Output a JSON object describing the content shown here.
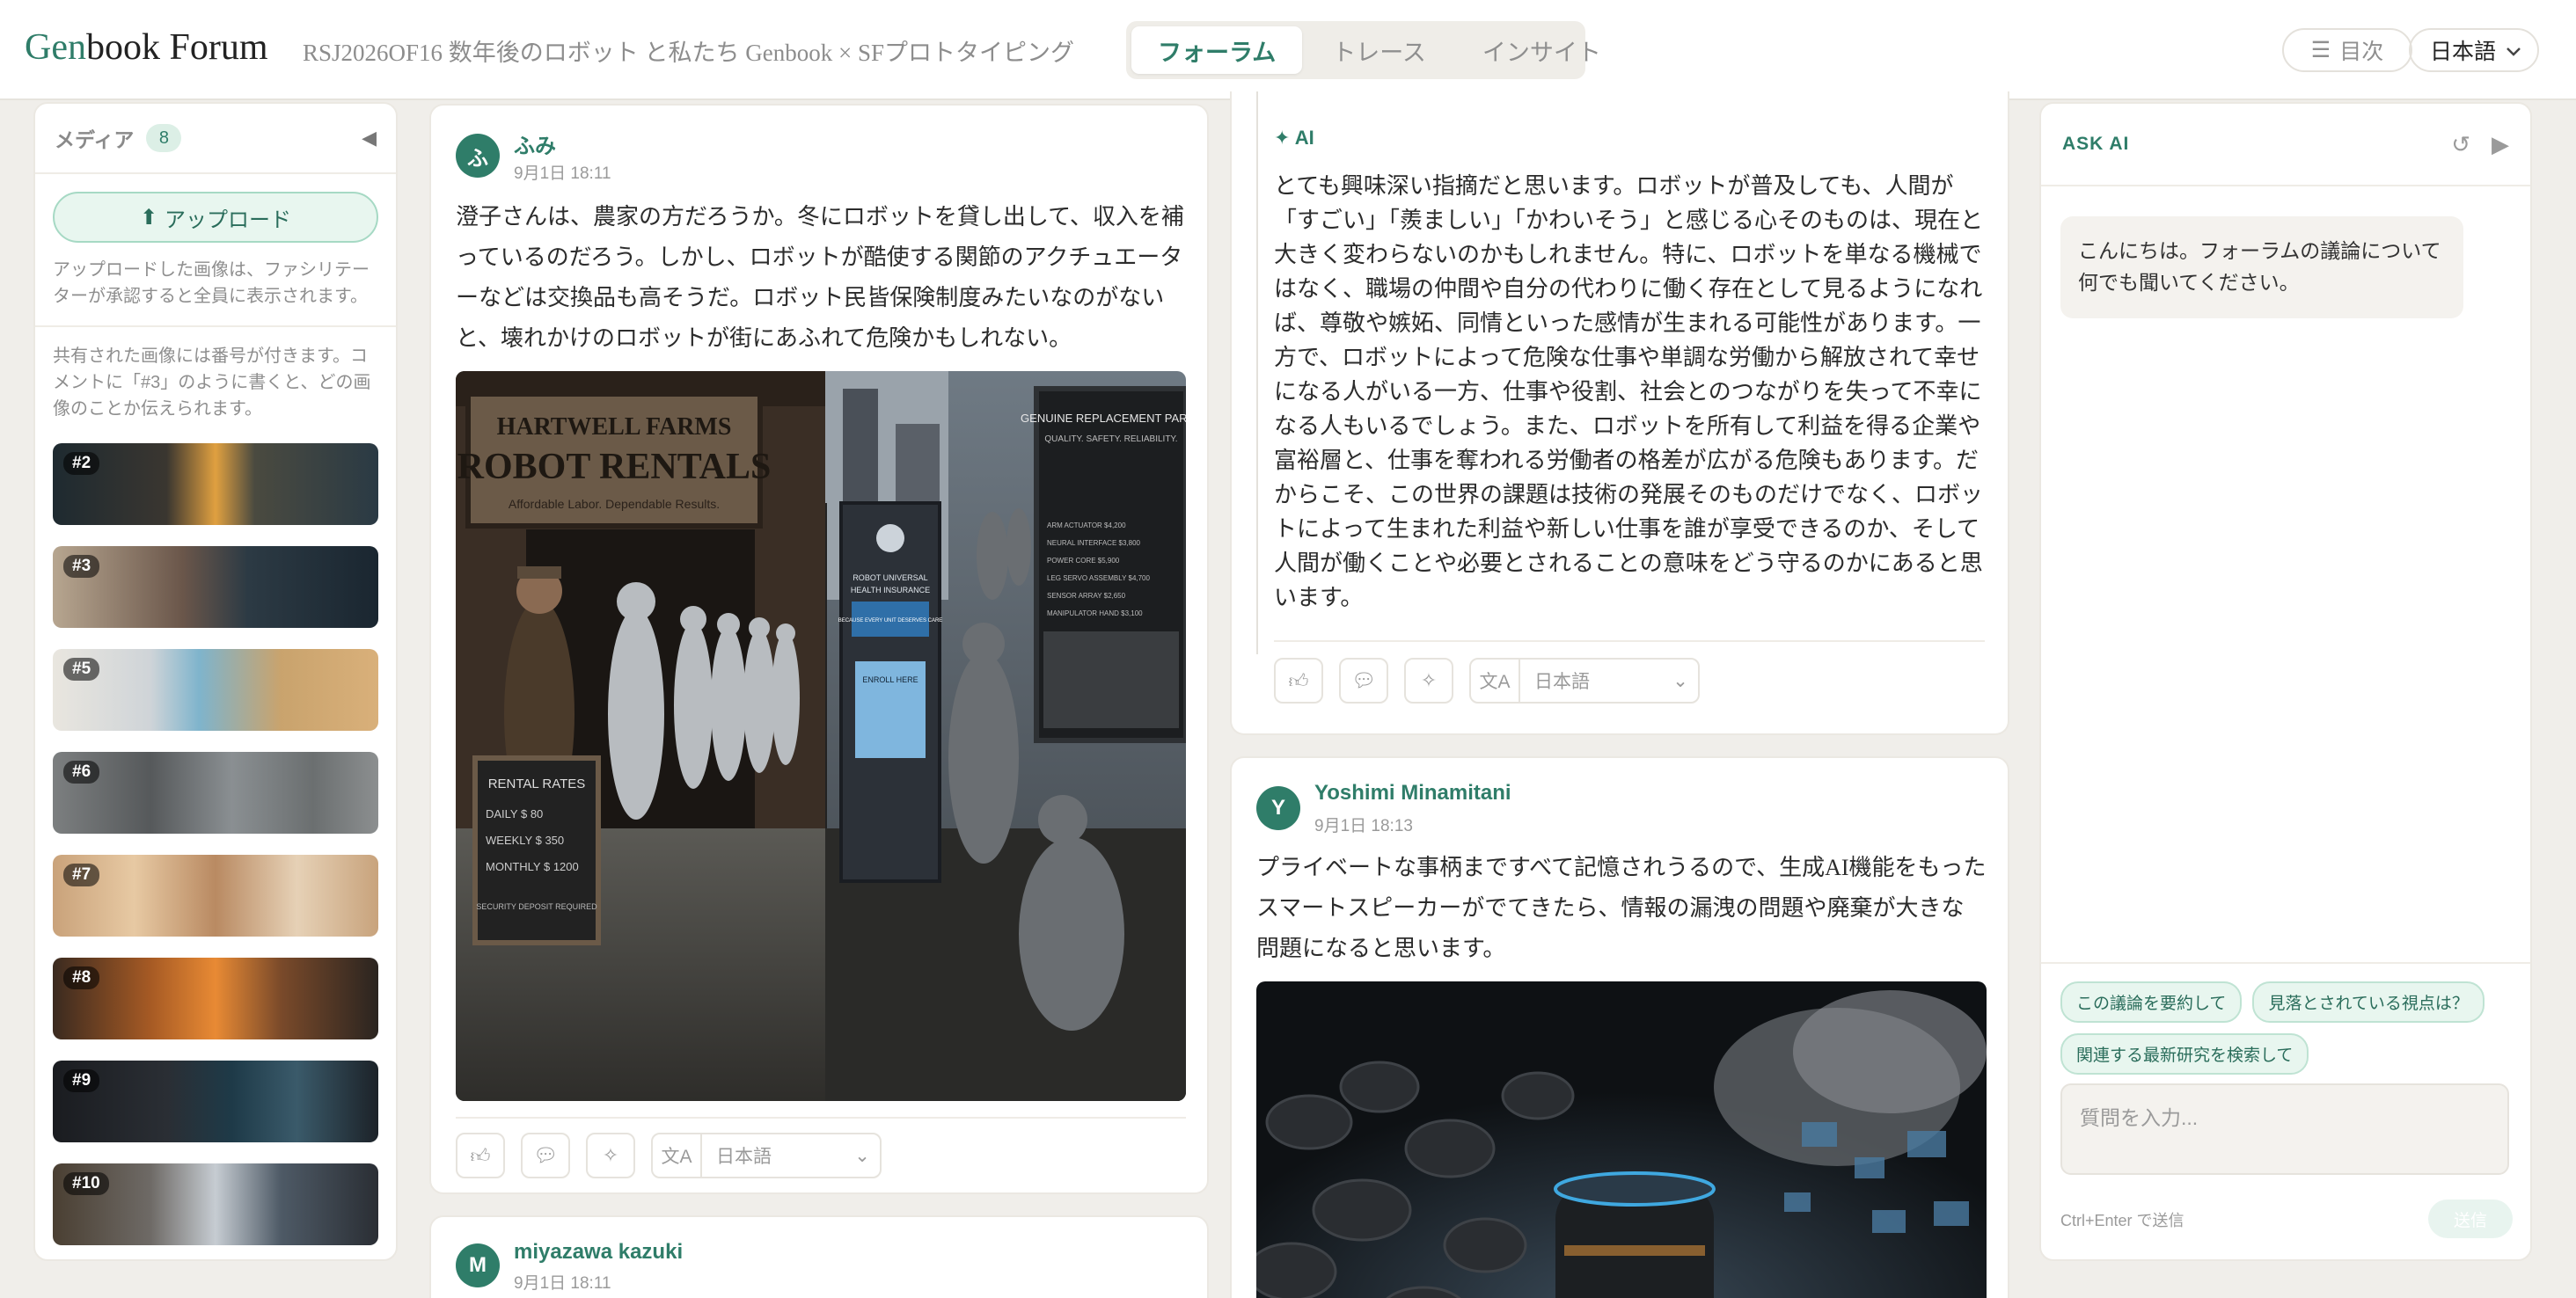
{
  "header": {
    "logo_gen": "Gen",
    "logo_rest": "book Forum",
    "subtitle": "RSJ2026OF16 数年後のロボット と私たち Genbook × SFプロトタイピング",
    "tabs": [
      {
        "label": "フォーラム",
        "active": true
      },
      {
        "label": "トレース",
        "active": false
      },
      {
        "label": "インサイト",
        "active": false
      }
    ],
    "toc_label": "目次",
    "language": "日本語"
  },
  "media": {
    "title": "メディア",
    "count": "8",
    "upload_label": "アップロード",
    "note": "アップロードした画像は、ファシリテーターが承認すると全員に表示されます。",
    "note2": "共有された画像には番号が付きます。コメントに「#3」のように書くと、どの画像のことか伝えられます。",
    "thumbnails": [
      "#2",
      "#3",
      "#5",
      "#6",
      "#7",
      "#8",
      "#9",
      "#10"
    ]
  },
  "posts": {
    "fumi": {
      "avatar": "ふ",
      "author": "ふみ",
      "time": "9月1日 18:11",
      "text": "澄子さんは、農家の方だろうか。冬にロボットを貸し出して、収入を補っているのだろう。しかし、ロボットが酷使する関節のアクチュエーターなどは交換品も高そうだ。ロボット民皆保険制度みたいなのがないと、壊れかけのロボットが街にあふれて危険かもしれない。",
      "image_text": {
        "farm_sign_1": "HARTWELL FARMS",
        "farm_sign_2": "ROBOT RENTALS",
        "farm_sign_3": "Affordable Labor. Dependable Results.",
        "rates_title": "RENTAL RATES",
        "rates": [
          "DAILY  $ 80",
          "WEEKLY  $ 350",
          "MONTHLY  $ 1200"
        ],
        "rates_note": "SECURITY DEPOSIT REQUIRED",
        "insurance_1": "ROBOT UNIVERSAL",
        "insurance_2": "HEALTH INSURANCE",
        "insurance_3": "BECAUSE EVERY UNIT DESERVES CARE",
        "enroll": "ENROLL HERE",
        "parts_title": "GENUINE REPLACEMENT PARTS",
        "parts_sub": "QUALITY. SAFETY. RELIABILITY.",
        "parts": [
          "ARM ACTUATOR  $4,200",
          "NEURAL INTERFACE  $3,800",
          "POWER CORE  $5,900",
          "LEG SERVO ASSEMBLY  $4,700",
          "SENSOR ARRAY  $2,650",
          "MANIPULATOR HAND  $3,100"
        ]
      },
      "translate_lang": "日本語"
    },
    "miyazawa": {
      "avatar": "M",
      "author": "miyazawa kazuki",
      "time": "9月1日 18:11"
    },
    "ai_reply": {
      "label": "AI",
      "text": "とても興味深い指摘だと思います。ロボットが普及しても、人間が「すごい」「羨ましい」「かわいそう」と感じる心そのものは、現在と大きく変わらないのかもしれません。特に、ロボットを単なる機械ではなく、職場の仲間や自分の代わりに働く存在として見るようになれば、尊敬や嫉妬、同情といった感情が生まれる可能性があります。一方で、ロボットによって危険な仕事や単調な労働から解放されて幸せになる人がいる一方、仕事や役割、社会とのつながりを失って不幸になる人もいるでしょう。また、ロボットを所有して利益を得る企業や富裕層と、仕事を奪われる労働者の格差が広がる危険もあります。だからこそ、この世界の課題は技術の発展そのものだけでなく、ロボットによって生まれた利益や新しい仕事を誰が享受できるのか、そして人間が働くことや必要とされることの意味をどう守るのかにあると思います。",
      "translate_lang": "日本語"
    },
    "yoshimi": {
      "avatar": "Y",
      "author": "Yoshimi Minamitani",
      "time": "9月1日 18:13",
      "text": "プライベートな事柄まですべて記憶されうるので、生成AI機能をもったスマートスピーカーがでてきたら、情報の漏洩の問題や廃棄が大きな問題になると思います。"
    }
  },
  "askai": {
    "title": "ASK AI",
    "greeting": "こんにちは。フォーラムの議論について何でも聞いてください。",
    "suggestions": [
      "この議論を要約して",
      "見落とされている視点は？",
      "関連する最新研究を検索して"
    ],
    "input_placeholder": "質問を入力...",
    "hint": "Ctrl+Enter で送信",
    "send_label": "送信"
  },
  "colors": {
    "accent": "#2f7d69",
    "background": "#f0eeea"
  }
}
